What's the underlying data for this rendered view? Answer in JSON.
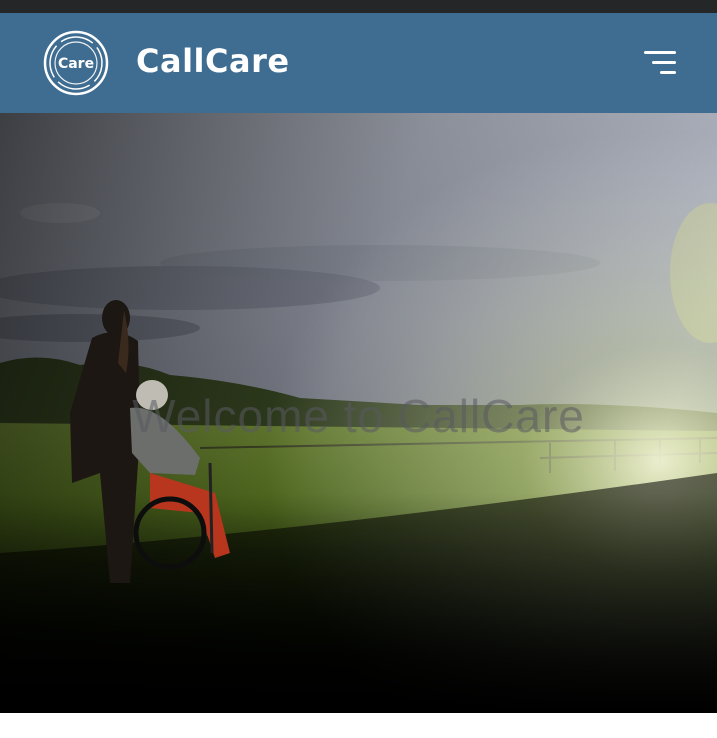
{
  "header": {
    "logo_text": "Care",
    "brand_name": "CallCare",
    "menu_icon": "hamburger-menu-icon"
  },
  "hero": {
    "title": "Welcome to CallCare",
    "image": "caregiver-with-wheelchair-field-photo"
  },
  "colors": {
    "header_bg": "#3f6d92",
    "top_strip": "#252627",
    "brand_text": "#ffffff"
  }
}
